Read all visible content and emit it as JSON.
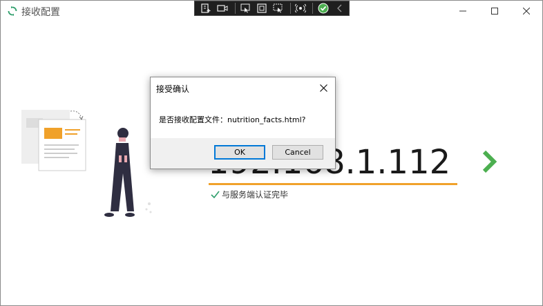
{
  "window": {
    "title": "接收配置",
    "controls": [
      "minimize",
      "maximize",
      "close"
    ]
  },
  "toolbar": {
    "icons": [
      "add-selection-icon",
      "video-icon",
      "pointer-icon",
      "window-select-icon",
      "region-select-icon",
      "audio-icon",
      "ok-icon",
      "collapse-icon"
    ]
  },
  "main": {
    "ip_address": "192.168.1.112",
    "status_text": "与服务端认证完毕",
    "accent_color": "#f0a12a",
    "next_color": "#4caf50"
  },
  "dialog": {
    "title": "接受确认",
    "message": "是否接收配置文件：nutrition_facts.html?",
    "ok_label": "OK",
    "cancel_label": "Cancel"
  }
}
